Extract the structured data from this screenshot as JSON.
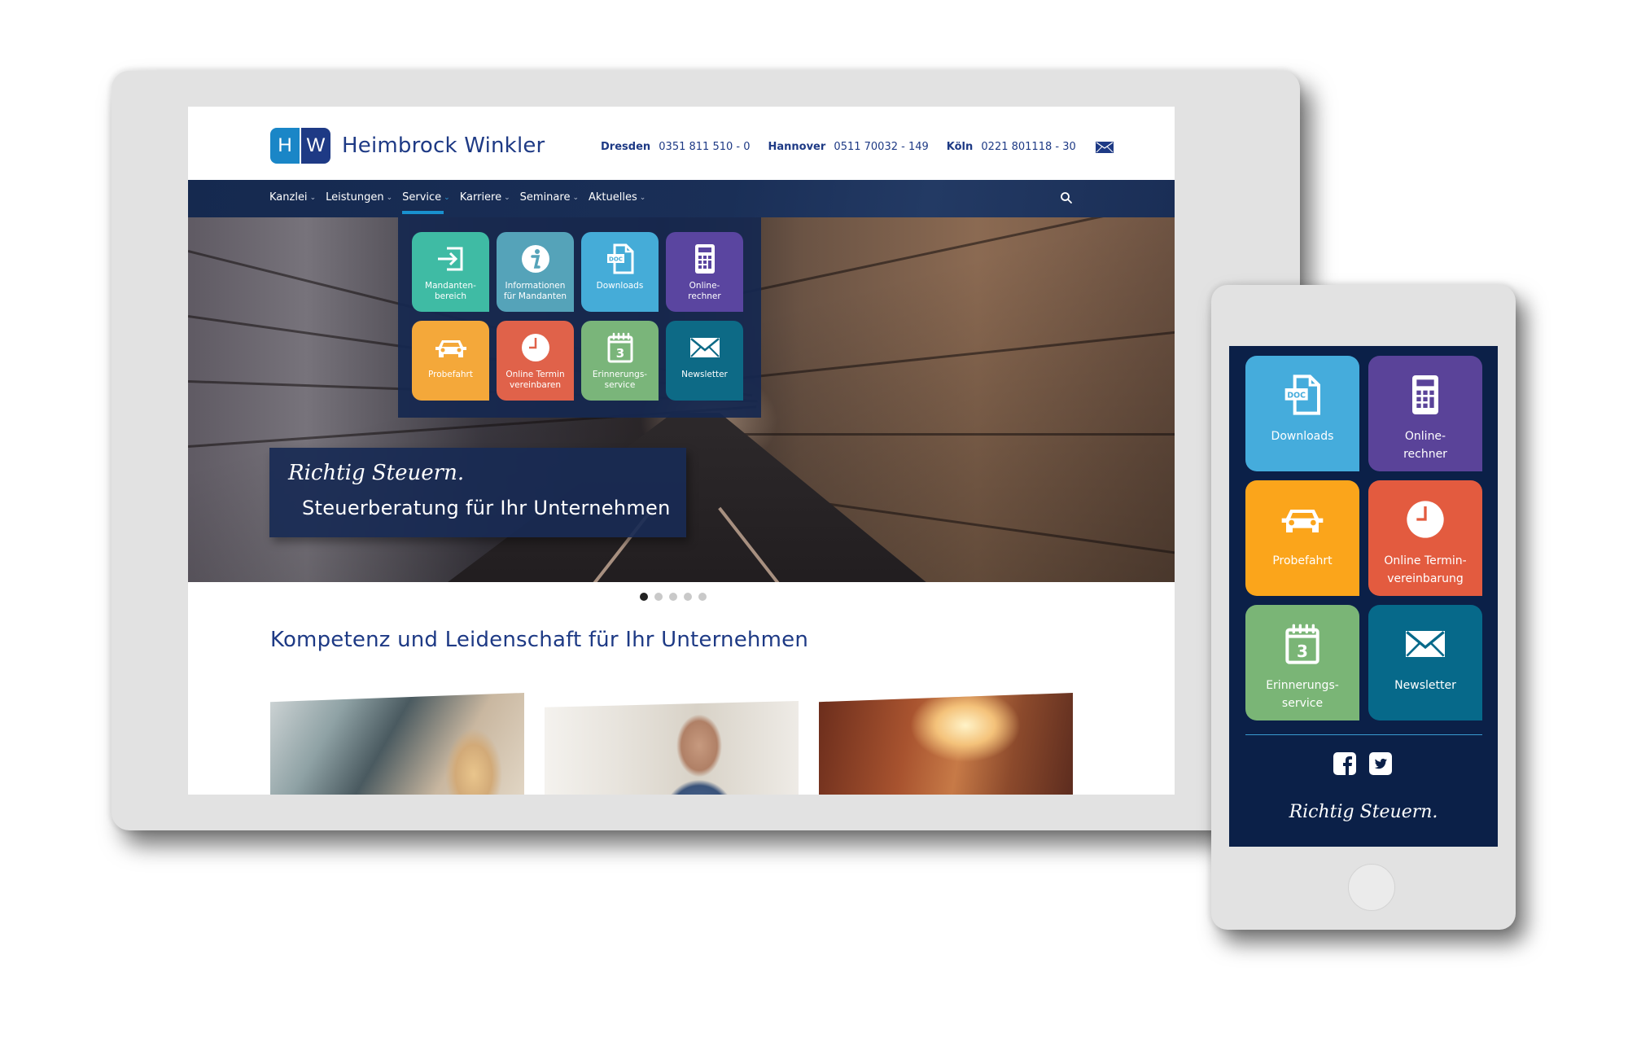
{
  "brand": {
    "logo_h": "H",
    "logo_w": "W",
    "name": "Heimbrock Winkler",
    "colors": {
      "primary": "#1e3a85",
      "accent": "#1a86c7",
      "nav_bg": "#15294f"
    }
  },
  "contacts": [
    {
      "city": "Dresden",
      "phone": "0351 811 510 - 0"
    },
    {
      "city": "Hannover",
      "phone": "0511 70032 - 149"
    },
    {
      "city": "Köln",
      "phone": "0221 801118 - 30"
    }
  ],
  "contact_icon": "mail-icon",
  "nav": {
    "items": [
      {
        "label": "Kanzlei",
        "active": false
      },
      {
        "label": "Leistungen",
        "active": false
      },
      {
        "label": "Service",
        "active": true
      },
      {
        "label": "Karriere",
        "active": false
      },
      {
        "label": "Seminare",
        "active": false
      },
      {
        "label": "Aktuelles",
        "active": false
      }
    ],
    "chevron": "⌄",
    "search_icon": "search-icon"
  },
  "service_menu": {
    "tiles": [
      {
        "label": "Mandanten-\nbereich",
        "icon": "login-icon",
        "color": "#3fbba4"
      },
      {
        "label": "Informationen\nfür Mandanten",
        "icon": "info-icon",
        "color": "#55a3b9"
      },
      {
        "label": "Downloads",
        "icon": "document-icon",
        "color": "#45acd8"
      },
      {
        "label": "Online-\nrechner",
        "icon": "calculator-icon",
        "color": "#5a45a0"
      },
      {
        "label": "Probefahrt",
        "icon": "car-icon",
        "color": "#f4a83a"
      },
      {
        "label": "Online Termin\nvereinbaren",
        "icon": "clock-icon",
        "color": "#e0624a"
      },
      {
        "label": "Erinnerungs-\nservice",
        "icon": "calendar-icon",
        "color": "#7ab57a"
      },
      {
        "label": "Newsletter",
        "icon": "envelope-icon",
        "color": "#0d6a86"
      }
    ]
  },
  "hero": {
    "script_line": "Richtig Steuern.",
    "subtitle": "Steuerberatung für Ihr Unternehmen",
    "slides_total": 5,
    "active_slide": 1
  },
  "section": {
    "title": "Kompetenz und Leidenschaft für Ihr Unternehmen"
  },
  "phone": {
    "tiles": [
      {
        "label": "Downloads",
        "icon": "document-icon",
        "color": "#45acdc"
      },
      {
        "label": "Online-\nrechner",
        "icon": "calculator-icon",
        "color": "#5a4399"
      },
      {
        "label": "Probefahrt",
        "icon": "car-icon",
        "color": "#fba51b"
      },
      {
        "label": "Online Termin-\nvereinbarung",
        "icon": "clock-icon",
        "color": "#e35b3f"
      },
      {
        "label": "Erinnerungs-\nservice",
        "icon": "calendar-icon",
        "color": "#7ab576"
      },
      {
        "label": "Newsletter",
        "icon": "envelope-icon",
        "color": "#06698a"
      }
    ],
    "social": [
      "facebook-icon",
      "twitter-icon"
    ],
    "script_line": "Richtig Steuern."
  }
}
